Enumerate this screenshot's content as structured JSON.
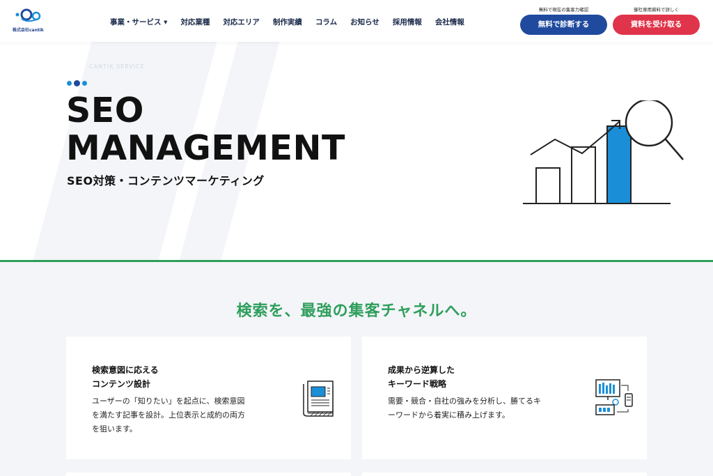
{
  "header": {
    "logo_text": "株式会社cantik",
    "nav": [
      {
        "label": "事業・サービス ▾"
      },
      {
        "label": "対応業種"
      },
      {
        "label": "対応エリア"
      },
      {
        "label": "制作実績"
      },
      {
        "label": "コラム"
      },
      {
        "label": "お知らせ"
      },
      {
        "label": "採用情報"
      },
      {
        "label": "会社情報"
      }
    ],
    "cta_diagnose": {
      "note": "無料で現在の集客力確認",
      "label": "無料で診断する"
    },
    "cta_document": {
      "note": "御社専用資料で詳しく",
      "label": "資料を受け取る"
    }
  },
  "hero": {
    "breadcrumb": "CANTIK SERVICE",
    "title_line1": "SEO",
    "title_line2": "MANAGEMENT",
    "subtitle": "SEO対策・コンテンツマーケティング"
  },
  "section": {
    "title": "検索を、最強の集客チャネルへ。",
    "cards": [
      {
        "heading_line1": "検索意図に応える",
        "heading_line2": "コンテンツ設計",
        "text_line1": "ユーザーの「知りたい」を起点に、検索意図",
        "text_line2": "を満たす記事を設計。上位表示と成約の両方",
        "text_line3": "を狙います。",
        "icon": "document-icon"
      },
      {
        "heading_line1": "成果から逆算した",
        "heading_line2": "キーワード戦略",
        "text_line1": "需要・競合・自社の強みを分析し、勝てるキ",
        "text_line2": "ーワードから着実に積み上げます。",
        "icon": "analytics-icon"
      }
    ]
  },
  "colors": {
    "brand_blue": "#1f4a9e",
    "cta_red": "#e0344a",
    "accent_green": "#2e9e5b",
    "illus_blue": "#1a8fd8"
  }
}
